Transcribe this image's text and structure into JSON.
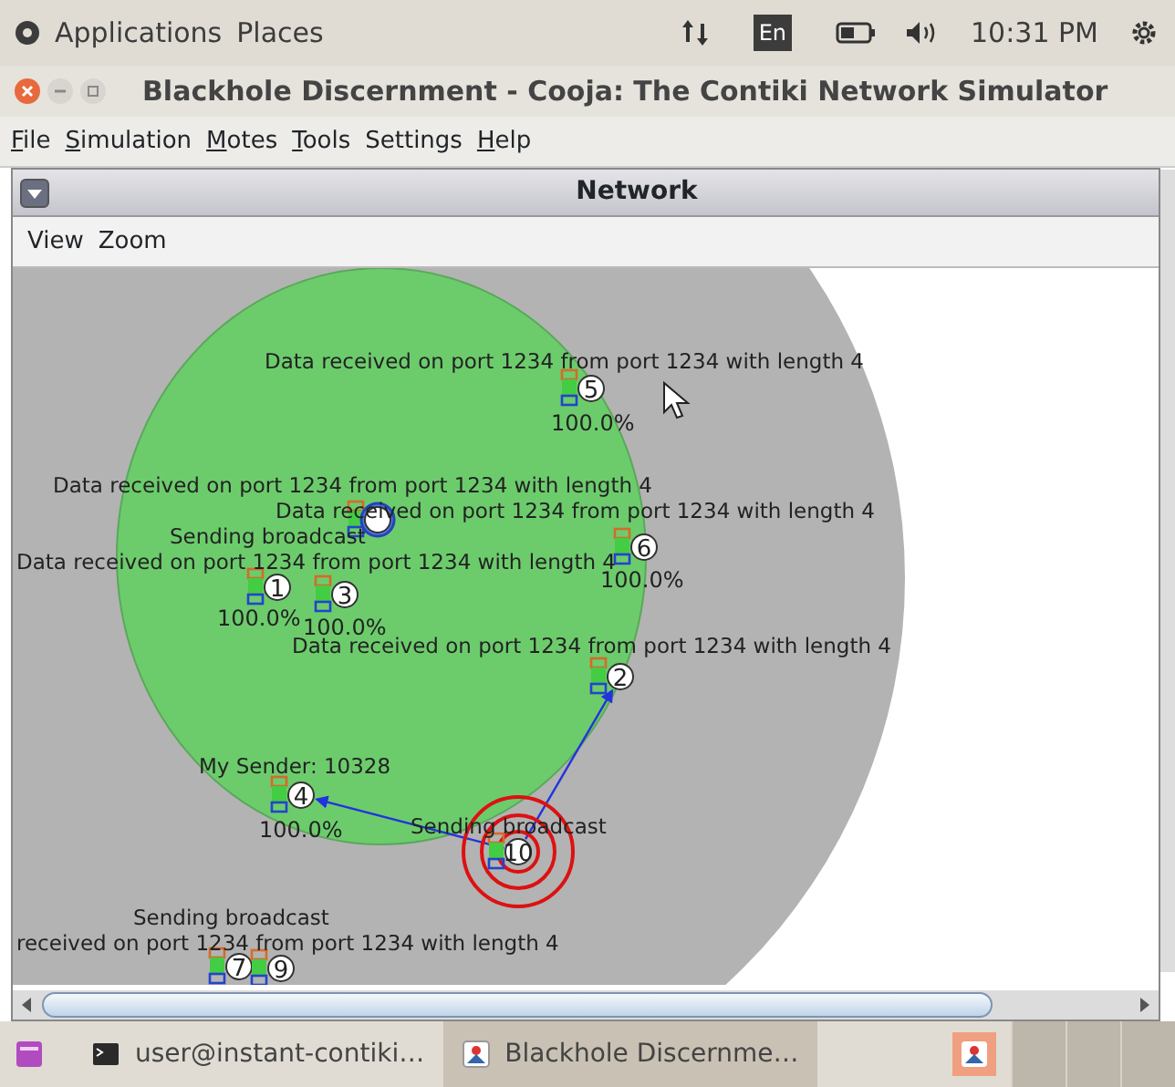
{
  "top_panel": {
    "menus": [
      "Applications",
      "Places"
    ],
    "keyboard": "En",
    "clock": "10:31 PM"
  },
  "window": {
    "title": "Blackhole Discernment - Cooja: The Contiki Network Simulator"
  },
  "menu_bar": [
    {
      "label": "File",
      "mnemonic": true
    },
    {
      "label": "Simulation",
      "mnemonic": true
    },
    {
      "label": "Motes",
      "mnemonic": true
    },
    {
      "label": "Tools",
      "mnemonic": true
    },
    {
      "label": "Settings",
      "mnemonic": false
    },
    {
      "label": "Help",
      "mnemonic": true
    }
  ],
  "network_panel": {
    "title": "Network",
    "menus": [
      "View",
      "Zoom"
    ],
    "canvas_texts": [
      "Data received on port 1234 from port 1234 with length 4",
      "Data received on port 1234 from port 1234 with length 4",
      "Data received on port 1234 from port 1234 with length 4",
      "Sending broadcast",
      "Data received on port 1234 from port 1234 with length 4",
      "Data received on port 1234 from port 1234 with length 4",
      "My Sender: 10328",
      "Sending broadcast",
      "Sending broadcast",
      "received on port 1234 from port 1234 with length 4"
    ],
    "motes": [
      {
        "id": "5",
        "reading": "100.0%",
        "selected": false,
        "transmitting": false,
        "receiving": false
      },
      {
        "selected": true,
        "transmitting": false,
        "receiving": false
      },
      {
        "id": "6",
        "reading": "100.0%",
        "selected": false,
        "transmitting": false,
        "receiving": false
      },
      {
        "id": "1",
        "reading": "100.0%",
        "selected": false,
        "transmitting": false,
        "receiving": false
      },
      {
        "id": "3",
        "reading": "100.0%",
        "selected": false,
        "transmitting": false,
        "receiving": false
      },
      {
        "id": "2",
        "selected": false,
        "transmitting": false,
        "receiving": true
      },
      {
        "id": "4",
        "reading": "100.0%",
        "selected": false,
        "transmitting": false,
        "receiving": true
      },
      {
        "id": "10",
        "selected": false,
        "transmitting": true,
        "receiving": false
      },
      {
        "id": "7",
        "selected": false,
        "transmitting": false,
        "receiving": false
      },
      {
        "id": "9",
        "selected": false,
        "transmitting": false,
        "receiving": false
      }
    ]
  },
  "taskbar": [
    {
      "kind": "terminal",
      "label": "user@instant-contiki…",
      "selected": false
    },
    {
      "kind": "app",
      "label": "Blackhole Discernme…",
      "selected": true
    }
  ]
}
